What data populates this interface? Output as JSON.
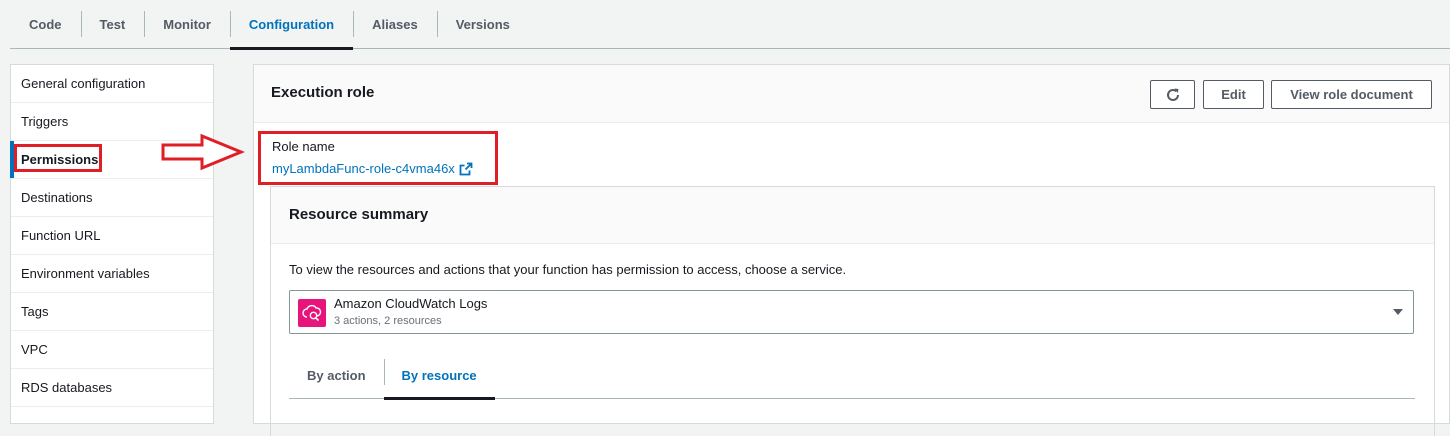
{
  "tabs": [
    {
      "label": "Code",
      "active": false
    },
    {
      "label": "Test",
      "active": false
    },
    {
      "label": "Monitor",
      "active": false
    },
    {
      "label": "Configuration",
      "active": true
    },
    {
      "label": "Aliases",
      "active": false
    },
    {
      "label": "Versions",
      "active": false
    }
  ],
  "sidebar": {
    "items": [
      {
        "label": "General configuration"
      },
      {
        "label": "Triggers"
      },
      {
        "label": "Permissions",
        "active": true
      },
      {
        "label": "Destinations"
      },
      {
        "label": "Function URL"
      },
      {
        "label": "Environment variables"
      },
      {
        "label": "Tags"
      },
      {
        "label": "VPC"
      },
      {
        "label": "RDS databases"
      }
    ]
  },
  "execution_role": {
    "title": "Execution role",
    "refresh_icon": "refresh-icon",
    "edit_label": "Edit",
    "view_label": "View role document",
    "role_label": "Role name",
    "role_name": "myLambdaFunc-role-c4vma46x",
    "external_icon": "external-link-icon"
  },
  "resource_summary": {
    "title": "Resource summary",
    "description": "To view the resources and actions that your function has permission to access, choose a service.",
    "service": {
      "name": "Amazon CloudWatch Logs",
      "detail": "3 actions, 2 resources",
      "icon": "cloudwatch-logs-icon"
    },
    "subtabs": [
      {
        "label": "By action",
        "active": false
      },
      {
        "label": "By resource",
        "active": true
      }
    ]
  },
  "colors": {
    "accent": "#0073bb",
    "highlight": "#e01e26",
    "service_icon_bg": "#e7157b"
  }
}
